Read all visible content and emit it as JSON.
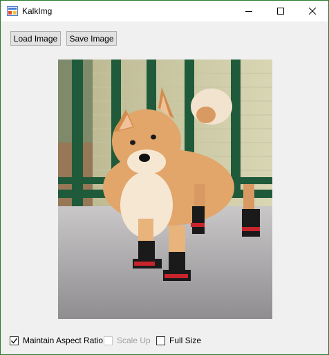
{
  "window": {
    "title": "KalkImg",
    "accent_border": "#2b7a2b"
  },
  "title_buttons": {
    "minimize_icon": "minimize-icon",
    "maximize_icon": "maximize-icon",
    "close_icon": "close-icon"
  },
  "toolbar": {
    "load_label": "Load Image",
    "save_label": "Save Image"
  },
  "image": {
    "subject": "shiba-inu-in-boots"
  },
  "options": {
    "maintain_aspect": {
      "label": "Maintain Aspect Ratio",
      "checked": true,
      "enabled": true
    },
    "scale_up": {
      "label": "Scale Up",
      "checked": false,
      "enabled": false
    },
    "full_size": {
      "label": "Full Size",
      "checked": false,
      "enabled": true
    }
  }
}
